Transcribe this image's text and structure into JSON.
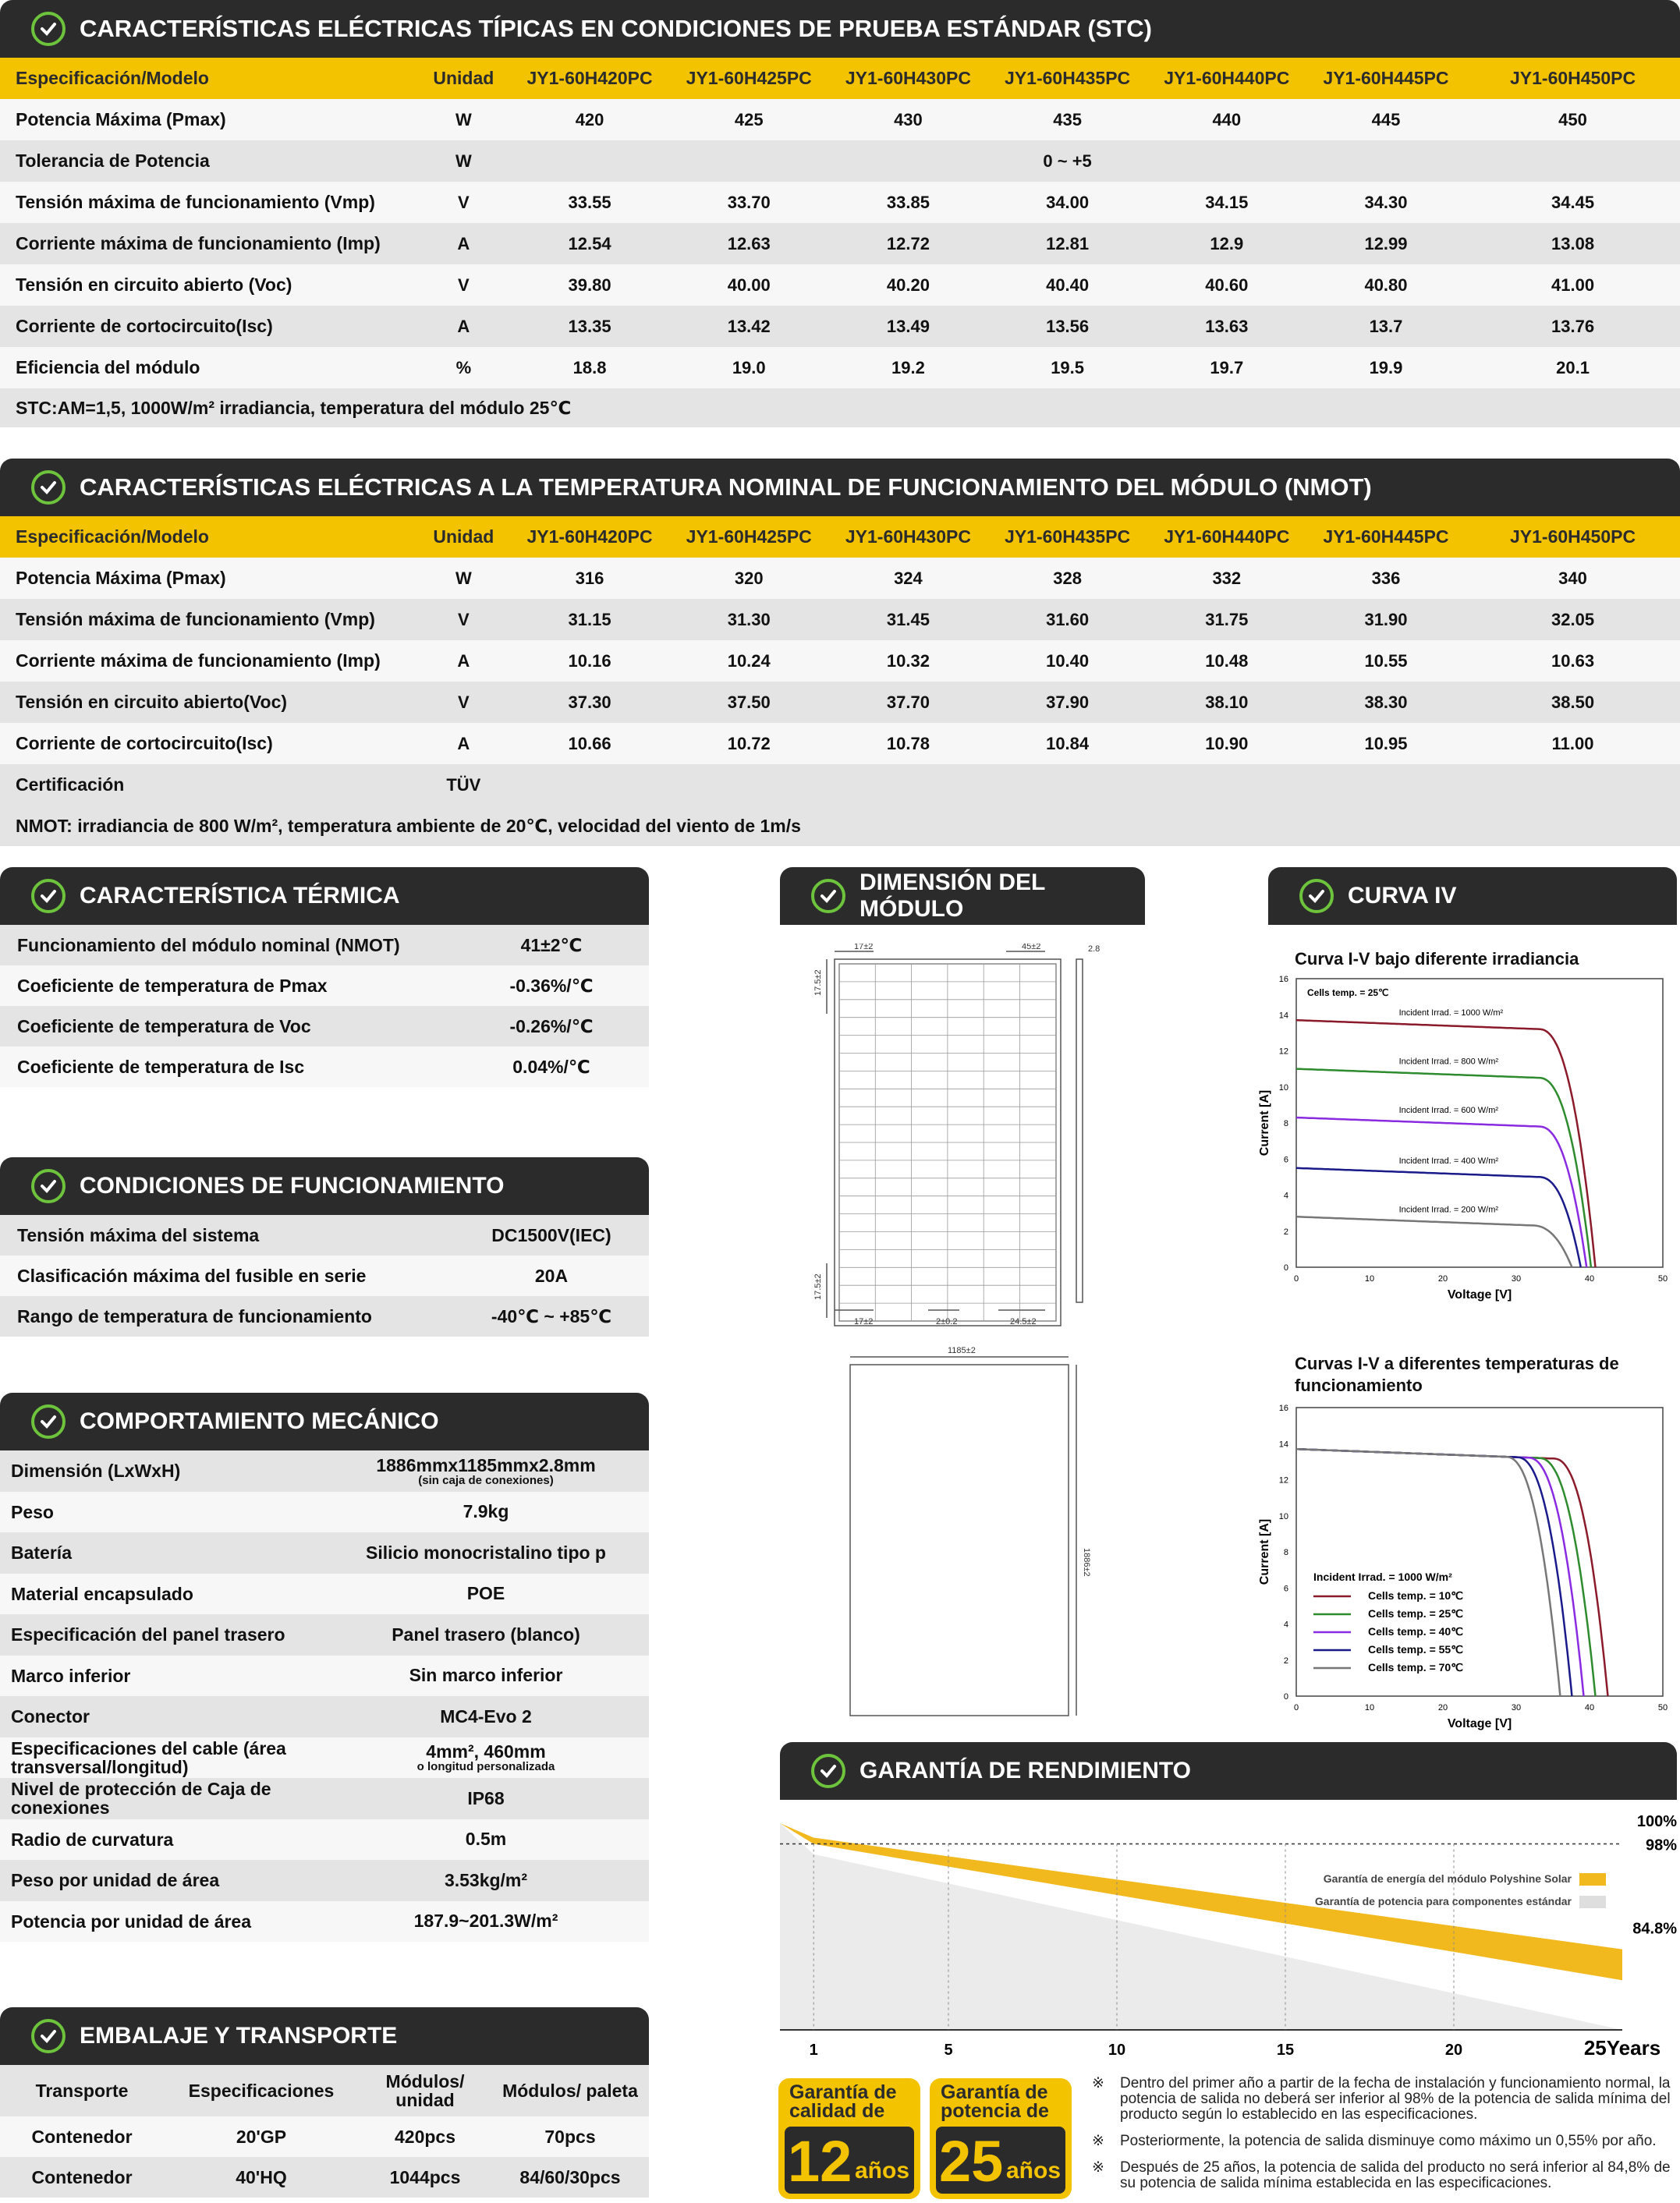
{
  "stc": {
    "title": "CARACTERÍSTICAS ELÉCTRICAS TÍPICAS EN CONDICIONES DE PRUEBA ESTÁNDAR (STC)",
    "head": [
      "Especificación/Modelo",
      "Unidad",
      "JY1-60H420PC",
      "JY1-60H425PC",
      "JY1-60H430PC",
      "JY1-60H435PC",
      "JY1-60H440PC",
      "JY1-60H445PC",
      "JY1-60H450PC"
    ],
    "rows": [
      [
        "Potencia Máxima (Pmax)",
        "W",
        "420",
        "425",
        "430",
        "435",
        "440",
        "445",
        "450"
      ],
      [
        "Tolerancia de Potencia",
        "W",
        "",
        "",
        "",
        "0 ~ +5",
        "",
        "",
        ""
      ],
      [
        "Tensión máxima de funcionamiento (Vmp)",
        "V",
        "33.55",
        "33.70",
        "33.85",
        "34.00",
        "34.15",
        "34.30",
        "34.45"
      ],
      [
        "Corriente máxima de funcionamiento (Imp)",
        "A",
        "12.54",
        "12.63",
        "12.72",
        "12.81",
        "12.9",
        "12.99",
        "13.08"
      ],
      [
        "Tensión en circuito abierto (Voc)",
        "V",
        "39.80",
        "40.00",
        "40.20",
        "40.40",
        "40.60",
        "40.80",
        "41.00"
      ],
      [
        "Corriente de cortocircuito(Isc)",
        "A",
        "13.35",
        "13.42",
        "13.49",
        "13.56",
        "13.63",
        "13.7",
        "13.76"
      ],
      [
        "Eficiencia del módulo",
        "%",
        "18.8",
        "19.0",
        "19.2",
        "19.5",
        "19.7",
        "19.9",
        "20.1"
      ]
    ],
    "note": "STC:AM=1,5, 1000W/m² irradiancia, temperatura del módulo 25℃"
  },
  "nmot": {
    "title": "CARACTERÍSTICAS ELÉCTRICAS A LA TEMPERATURA NOMINAL DE FUNCIONAMIENTO DEL MÓDULO (NMOT)",
    "head": [
      "Especificación/Modelo",
      "Unidad",
      "JY1-60H420PC",
      "JY1-60H425PC",
      "JY1-60H430PC",
      "JY1-60H435PC",
      "JY1-60H440PC",
      "JY1-60H445PC",
      "JY1-60H450PC"
    ],
    "rows": [
      [
        "Potencia Máxima (Pmax)",
        "W",
        "316",
        "320",
        "324",
        "328",
        "332",
        "336",
        "340"
      ],
      [
        "Tensión máxima de funcionamiento (Vmp)",
        "V",
        "31.15",
        "31.30",
        "31.45",
        "31.60",
        "31.75",
        "31.90",
        "32.05"
      ],
      [
        "Corriente máxima de funcionamiento (Imp)",
        "A",
        "10.16",
        "10.24",
        "10.32",
        "10.40",
        "10.48",
        "10.55",
        "10.63"
      ],
      [
        "Tensión en circuito abierto(Voc)",
        "V",
        "37.30",
        "37.50",
        "37.70",
        "37.90",
        "38.10",
        "38.30",
        "38.50"
      ],
      [
        "Corriente de cortocircuito(Isc)",
        "A",
        "10.66",
        "10.72",
        "10.78",
        "10.84",
        "10.90",
        "10.95",
        "11.00"
      ],
      [
        "Certificación",
        "TÜV",
        "",
        "",
        "",
        "",
        "",
        "",
        ""
      ]
    ],
    "note": "NMOT: irradiancia de 800 W/m², temperatura ambiente de 20℃, velocidad del viento de 1m/s"
  },
  "thermal": {
    "title": "CARACTERÍSTICA TÉRMICA",
    "rows": [
      [
        "Funcionamiento del módulo nominal (NMOT)",
        "41±2℃"
      ],
      [
        "Coeficiente de temperatura de Pmax",
        "-0.36%/℃"
      ],
      [
        "Coeficiente de temperatura de Voc",
        "-0.26%/℃"
      ],
      [
        "Coeficiente de temperatura de Isc",
        "0.04%/℃"
      ]
    ]
  },
  "operating": {
    "title": "CONDICIONES DE FUNCIONAMIENTO",
    "rows": [
      [
        "Tensión máxima del sistema",
        "DC1500V(IEC)"
      ],
      [
        "Clasificación máxima del fusible en serie",
        "20A"
      ],
      [
        "Rango de temperatura de funcionamiento",
        "-40℃ ~ +85℃"
      ]
    ]
  },
  "mechanical": {
    "title": "COMPORTAMIENTO MECÁNICO",
    "rows": [
      [
        "Dimensión (LxWxH)",
        "1886mmx1185mmx2.8mm",
        "(sin caja de conexiones)"
      ],
      [
        "Peso",
        "7.9kg",
        ""
      ],
      [
        "Batería",
        "Silicio monocristalino tipo p",
        ""
      ],
      [
        "Material encapsulado",
        "POE",
        ""
      ],
      [
        "Especificación del panel trasero",
        "Panel trasero (blanco)",
        ""
      ],
      [
        "Marco inferior",
        "Sin marco inferior",
        ""
      ],
      [
        "Conector",
        "MC4-Evo 2",
        ""
      ],
      [
        "Especificaciones del cable (área transversal/longitud)",
        "4mm², 460mm",
        "o longitud personalizada"
      ],
      [
        "Nivel de protección de Caja de conexiones",
        "IP68",
        ""
      ],
      [
        "Radio de curvatura",
        "0.5m",
        ""
      ],
      [
        "Peso por unidad de área",
        "3.53kg/m²",
        ""
      ],
      [
        "Potencia por unidad de área",
        "187.9~201.3W/m²",
        ""
      ]
    ]
  },
  "packaging": {
    "title": "EMBALAJE Y TRANSPORTE",
    "head": [
      "Transporte",
      "Especificaciones",
      "Módulos/ unidad",
      "Módulos/ paleta"
    ],
    "rows": [
      [
        "Contenedor",
        "20'GP",
        "420pcs",
        "70pcs"
      ],
      [
        "Contenedor",
        "40'HQ",
        "1044pcs",
        "84/60/30pcs"
      ]
    ]
  },
  "dimension": {
    "title": "DIMENSIÓN DEL MÓDULO",
    "labels": [
      "17±2",
      "45±2",
      "2.8",
      "17.5±2",
      "17.5±2",
      "17±2",
      "2±0.2",
      "24.5±2",
      "1185±2",
      "1886±2"
    ]
  },
  "curva": {
    "title": "CURVA IV"
  },
  "chart_data": [
    {
      "type": "line",
      "title": "Curva I-V bajo diferente irradiancia",
      "xlabel": "Voltage [V]",
      "ylabel": "Current [A]",
      "xlim": [
        0,
        50
      ],
      "ylim": [
        0,
        16
      ],
      "xticks": [
        0,
        10,
        20,
        30,
        40,
        50
      ],
      "yticks": [
        0,
        2,
        4,
        6,
        8,
        10,
        12,
        14,
        16
      ],
      "annotation": "Cells temp. = 25℃",
      "series": [
        {
          "name": "Incident Irrad. = 1000 W/m²",
          "color": "#8b1a2b",
          "isc": 13.7,
          "voc": 40.8,
          "knee": 33
        },
        {
          "name": "Incident Irrad. = 800 W/m²",
          "color": "#2e8b2e",
          "isc": 11.0,
          "voc": 40.2,
          "knee": 33
        },
        {
          "name": "Incident Irrad. = 600 W/m²",
          "color": "#8a2be2",
          "isc": 8.3,
          "voc": 39.6,
          "knee": 33
        },
        {
          "name": "Incident Irrad. = 400 W/m²",
          "color": "#1a1a8b",
          "isc": 5.5,
          "voc": 38.8,
          "knee": 33
        },
        {
          "name": "Incident Irrad. = 200 W/m²",
          "color": "#777777",
          "isc": 2.8,
          "voc": 37.6,
          "knee": 32
        }
      ]
    },
    {
      "type": "line",
      "title": "Curvas I-V a diferentes temperaturas de funcionamiento",
      "xlabel": "Voltage [V]",
      "ylabel": "Current [A]",
      "xlim": [
        0,
        50
      ],
      "ylim": [
        0,
        16
      ],
      "xticks": [
        0,
        10,
        20,
        30,
        40,
        50
      ],
      "yticks": [
        0,
        2,
        4,
        6,
        8,
        10,
        12,
        14,
        16
      ],
      "annotation": "Incident Irrad. = 1000 W/m²",
      "series": [
        {
          "name": "Cells temp. = 10℃",
          "color": "#8b1a2b",
          "isc": 13.7,
          "voc": 42.5,
          "knee": 35
        },
        {
          "name": "Cells temp. = 25℃",
          "color": "#2e8b2e",
          "isc": 13.7,
          "voc": 40.8,
          "knee": 33
        },
        {
          "name": "Cells temp. = 40℃",
          "color": "#8a2be2",
          "isc": 13.7,
          "voc": 39.2,
          "knee": 31.5
        },
        {
          "name": "Cells temp. = 55℃",
          "color": "#1a1a8b",
          "isc": 13.7,
          "voc": 37.6,
          "knee": 30
        },
        {
          "name": "Cells temp. = 70℃",
          "color": "#777777",
          "isc": 13.7,
          "voc": 36.0,
          "knee": 28.5
        }
      ]
    },
    {
      "type": "area",
      "title": "",
      "x": [
        0,
        1,
        25
      ],
      "ylim": [
        84.8,
        100
      ],
      "xticks": [
        "1",
        "5",
        "10",
        "15",
        "20",
        "25Years"
      ],
      "ytick_labels": [
        "100%",
        "98%",
        "84.8%"
      ],
      "series": [
        {
          "name": "Garantía de energía del módulo Polyshine Solar",
          "color": "#f2b91e",
          "upper": [
            100,
            98.6,
            87.8
          ],
          "lower": [
            100,
            98,
            84.8
          ]
        },
        {
          "name": "Garantía de potencia para componentes estándar",
          "color": "#ebebeb",
          "values": [
            null,
            97,
            80
          ]
        }
      ]
    }
  ],
  "warranty": {
    "title": "GARANTÍA DE RENDIMIENTO",
    "badge1_top": "Garantía de calidad de",
    "badge1_num": "12",
    "badge1_unit": "años",
    "badge2_top": "Garantía de potencia de",
    "badge2_num": "25",
    "badge2_unit": "años",
    "notes": [
      "Dentro del primer año a partir de la fecha de instalación y funcionamiento normal, la potencia de salida no deberá ser inferior al 98% de la potencia de salida mínima del producto según lo establecido en las especificaciones.",
      "Posteriormente, la potencia de salida disminuye como máximo un 0,55% por año.",
      "Después de 25 años, la potencia de salida del producto no será inferior al 84,8% de su potencia de salida mínima establecida en las especificaciones."
    ],
    "note_mark": "※"
  }
}
